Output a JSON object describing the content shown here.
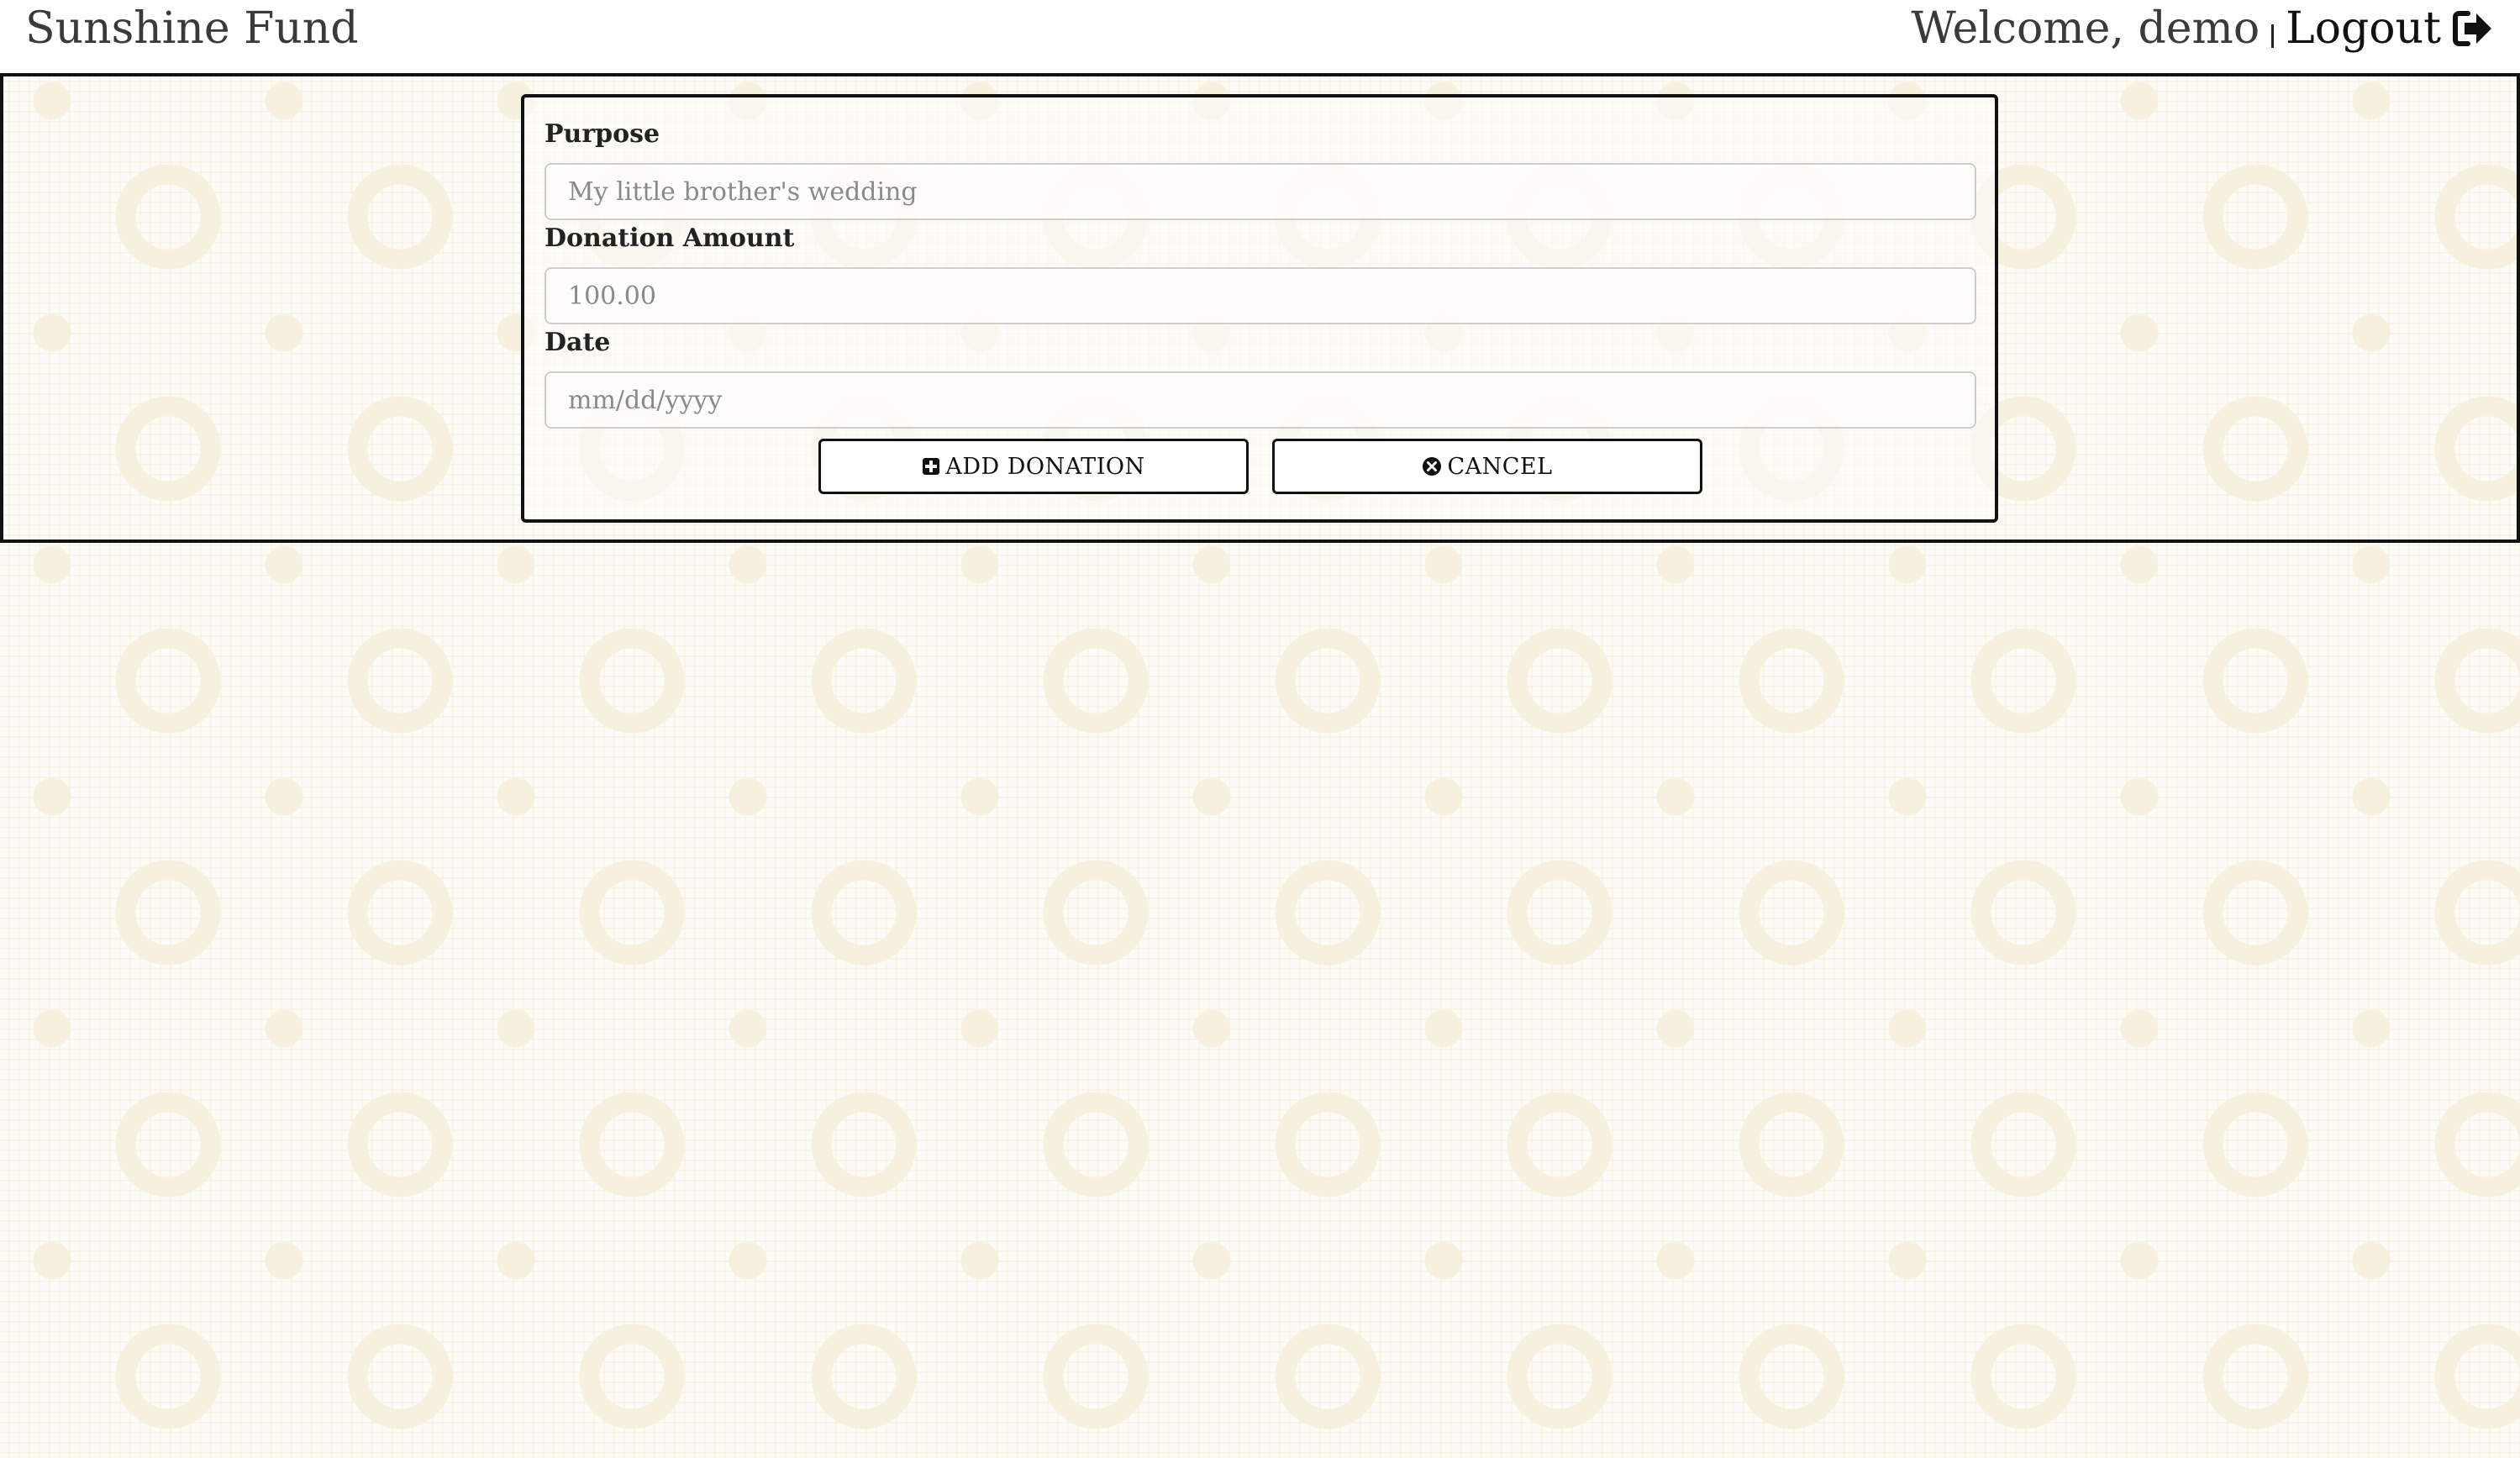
{
  "header": {
    "brand": "Sunshine Fund",
    "welcome": "Welcome, demo",
    "logout_label": "Logout",
    "logout_icon": "sign-out-icon"
  },
  "form": {
    "purpose": {
      "label": "Purpose",
      "placeholder": "My little brother's wedding",
      "value": ""
    },
    "amount": {
      "label": "Donation Amount",
      "placeholder": "100.00",
      "value": ""
    },
    "date": {
      "label": "Date",
      "placeholder": "mm/dd/yyyy",
      "value": ""
    },
    "add_button": {
      "label": "ADD DONATION",
      "icon": "plus-square-icon"
    },
    "cancel_button": {
      "label": "CANCEL",
      "icon": "times-circle-icon"
    }
  },
  "colors": {
    "background": "#fcfbf7",
    "pattern": "#f6f1df",
    "border": "#111111",
    "input_border": "#cfcfcf"
  }
}
